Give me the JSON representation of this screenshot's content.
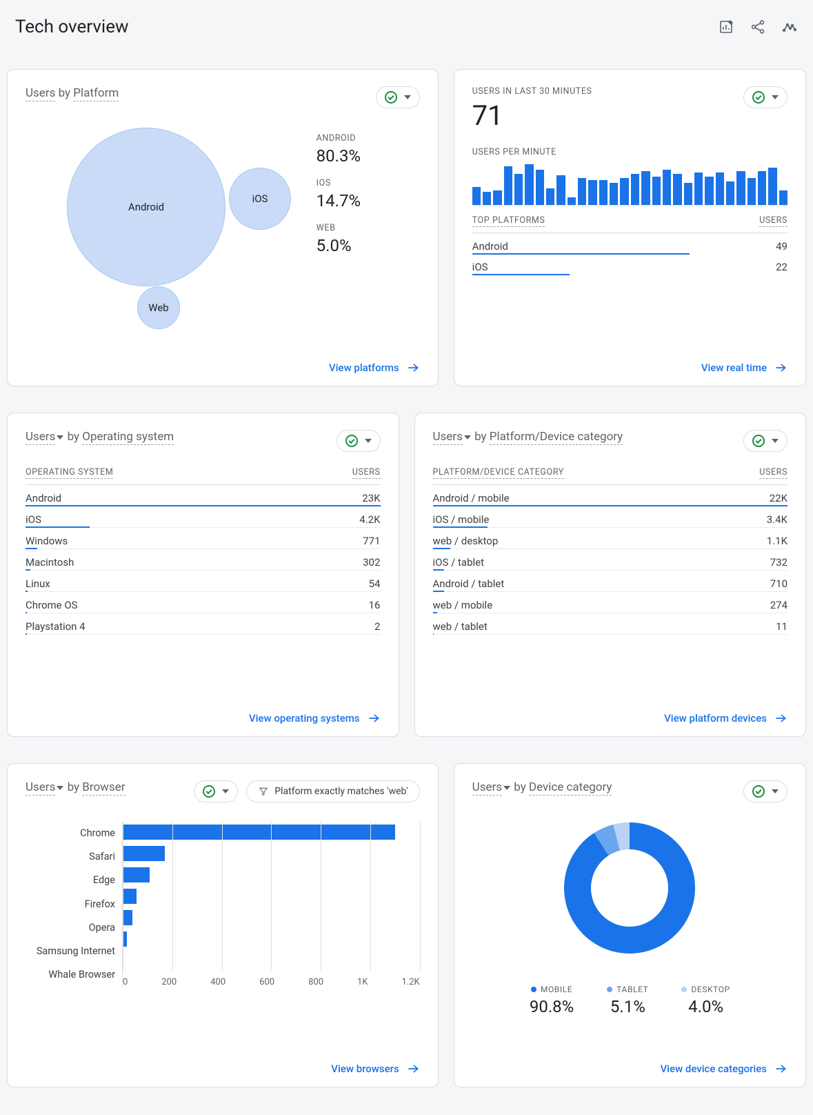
{
  "page_title": "Tech overview",
  "card_platform": {
    "title_metric": "Users",
    "title_by": " by ",
    "title_dim": "Platform",
    "items": [
      {
        "label": "ANDROID",
        "value": "80.3%",
        "bubble_label": "Android",
        "bubble_d": 230,
        "bubble_x": 60,
        "bubble_y": 20
      },
      {
        "label": "IOS",
        "value": "14.7%",
        "bubble_label": "iOS",
        "bubble_d": 90,
        "bubble_x": 295,
        "bubble_y": 78
      },
      {
        "label": "WEB",
        "value": "5.0%",
        "bubble_label": "Web",
        "bubble_d": 62,
        "bubble_x": 162,
        "bubble_y": 250
      }
    ],
    "footer": "View platforms"
  },
  "card_realtime": {
    "label1": "USERS IN LAST 30 MINUTES",
    "count": "71",
    "label2": "USERS PER MINUTE",
    "bars": [
      24,
      18,
      20,
      52,
      42,
      55,
      48,
      22,
      40,
      10,
      36,
      34,
      34,
      30,
      36,
      42,
      46,
      38,
      48,
      42,
      30,
      44,
      38,
      44,
      32,
      46,
      36,
      46,
      50,
      20
    ],
    "top_head_left": "TOP PLATFORMS",
    "top_head_right": "USERS",
    "rows": [
      {
        "label": "Android",
        "value": "49",
        "bar_pct": 69
      },
      {
        "label": "iOS",
        "value": "22",
        "bar_pct": 31
      }
    ],
    "footer": "View real time"
  },
  "card_os": {
    "title_metric": "Users",
    "title_by": " by ",
    "title_dim": "Operating system",
    "head_left": "OPERATING SYSTEM",
    "head_right": "USERS",
    "rows": [
      {
        "label": "Android",
        "value": "23K",
        "bar_pct": 100
      },
      {
        "label": "iOS",
        "value": "4.2K",
        "bar_pct": 18
      },
      {
        "label": "Windows",
        "value": "771",
        "bar_pct": 3.4
      },
      {
        "label": "Macintosh",
        "value": "302",
        "bar_pct": 1.3
      },
      {
        "label": "Linux",
        "value": "54",
        "bar_pct": 0.6
      },
      {
        "label": "Chrome OS",
        "value": "16",
        "bar_pct": 0.4
      },
      {
        "label": "Playstation 4",
        "value": "2",
        "bar_pct": 0.3
      }
    ],
    "footer": "View operating systems"
  },
  "card_platdev": {
    "title_metric": "Users",
    "title_by": " by ",
    "title_dim": "Platform/Device category",
    "head_left": "PLATFORM/DEVICE CATEGORY",
    "head_right": "USERS",
    "rows": [
      {
        "label": "Android / mobile",
        "value": "22K",
        "bar_pct": 100
      },
      {
        "label": "iOS / mobile",
        "value": "3.4K",
        "bar_pct": 15.5
      },
      {
        "label": "web / desktop",
        "value": "1.1K",
        "bar_pct": 5
      },
      {
        "label": "iOS / tablet",
        "value": "732",
        "bar_pct": 3.3
      },
      {
        "label": "Android / tablet",
        "value": "710",
        "bar_pct": 3.2
      },
      {
        "label": "web / mobile",
        "value": "274",
        "bar_pct": 1.2
      },
      {
        "label": "web / tablet",
        "value": "11",
        "bar_pct": 0.3
      }
    ],
    "footer": "View platform devices"
  },
  "card_browser": {
    "title_metric": "Users",
    "title_by": " by ",
    "title_dim": "Browser",
    "filter_text": "Platform exactly matches 'web'",
    "rows": [
      {
        "label": "Chrome",
        "value": 1100
      },
      {
        "label": "Safari",
        "value": 170
      },
      {
        "label": "Edge",
        "value": 110
      },
      {
        "label": "Firefox",
        "value": 55
      },
      {
        "label": "Opera",
        "value": 38
      },
      {
        "label": "Samsung Internet",
        "value": 16
      },
      {
        "label": "Whale Browser",
        "value": 4
      }
    ],
    "ticks": [
      "0",
      "200",
      "400",
      "600",
      "800",
      "1K",
      "1.2K"
    ],
    "max": 1200,
    "footer": "View browsers"
  },
  "card_device": {
    "title_metric": "Users",
    "title_by": " by ",
    "title_dim": "Device category",
    "items": [
      {
        "label": "MOBILE",
        "value": "90.8%",
        "color": "#1a73e8",
        "num": 90.8
      },
      {
        "label": "TABLET",
        "value": "5.1%",
        "color": "#6ba5ee",
        "num": 5.1
      },
      {
        "label": "DESKTOP",
        "value": "4.0%",
        "color": "#b9d2f6",
        "num": 4.0
      }
    ],
    "footer": "View device categories"
  },
  "chart_data": [
    {
      "type": "bubble",
      "title": "Users by Platform",
      "series": [
        {
          "name": "Android",
          "value": 80.3
        },
        {
          "name": "iOS",
          "value": 14.7
        },
        {
          "name": "Web",
          "value": 5.0
        }
      ]
    },
    {
      "type": "bar",
      "title": "Users per minute (last 30)",
      "values": [
        24,
        18,
        20,
        52,
        42,
        55,
        48,
        22,
        40,
        10,
        36,
        34,
        34,
        30,
        36,
        42,
        46,
        38,
        48,
        42,
        30,
        44,
        38,
        44,
        32,
        46,
        36,
        46,
        50,
        20
      ]
    },
    {
      "type": "bar",
      "title": "Users by Browser",
      "orientation": "horizontal",
      "categories": [
        "Chrome",
        "Safari",
        "Edge",
        "Firefox",
        "Opera",
        "Samsung Internet",
        "Whale Browser"
      ],
      "values": [
        1100,
        170,
        110,
        55,
        38,
        16,
        4
      ],
      "xlim": [
        0,
        1200
      ],
      "xticks": [
        0,
        200,
        400,
        600,
        800,
        1000,
        1200
      ],
      "filter": "Platform exactly matches 'web'"
    },
    {
      "type": "pie",
      "title": "Users by Device category",
      "series": [
        {
          "name": "mobile",
          "value": 90.8
        },
        {
          "name": "tablet",
          "value": 5.1
        },
        {
          "name": "desktop",
          "value": 4.0
        }
      ],
      "style": "donut"
    },
    {
      "type": "table",
      "title": "Users by Operating system",
      "columns": [
        "Operating system",
        "Users"
      ],
      "rows": [
        [
          "Android",
          23000
        ],
        [
          "iOS",
          4200
        ],
        [
          "Windows",
          771
        ],
        [
          "Macintosh",
          302
        ],
        [
          "Linux",
          54
        ],
        [
          "Chrome OS",
          16
        ],
        [
          "Playstation 4",
          2
        ]
      ]
    },
    {
      "type": "table",
      "title": "Users by Platform/Device category",
      "columns": [
        "Platform/Device category",
        "Users"
      ],
      "rows": [
        [
          "Android / mobile",
          22000
        ],
        [
          "iOS / mobile",
          3400
        ],
        [
          "web / desktop",
          1100
        ],
        [
          "iOS / tablet",
          732
        ],
        [
          "Android / tablet",
          710
        ],
        [
          "web / mobile",
          274
        ],
        [
          "web / tablet",
          11
        ]
      ]
    },
    {
      "type": "table",
      "title": "Top platforms (last 30 min)",
      "columns": [
        "Platform",
        "Users"
      ],
      "rows": [
        [
          "Android",
          49
        ],
        [
          "iOS",
          22
        ]
      ]
    }
  ]
}
